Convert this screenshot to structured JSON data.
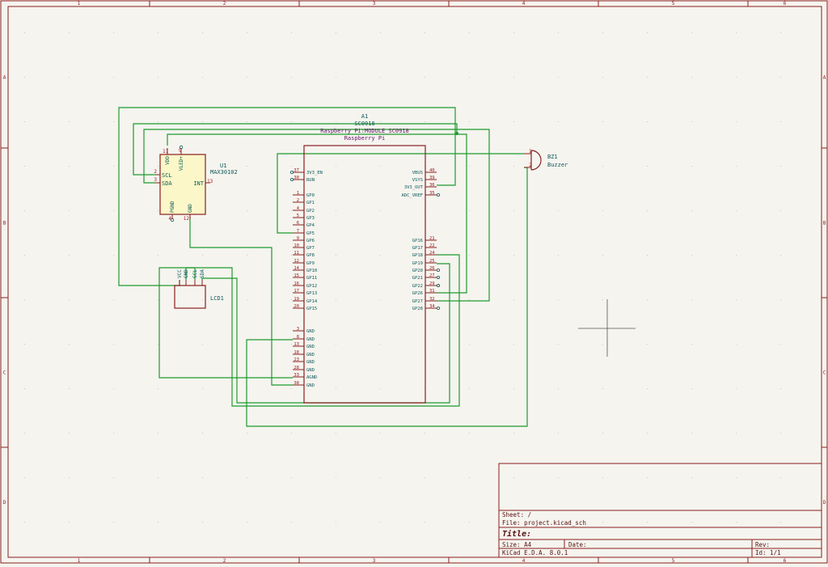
{
  "colors": {
    "background": "#f5f4ef",
    "frame": "#8a1e1e",
    "wire": "#1f9a2c",
    "symbol_body": "#8a1e1e",
    "symbol_fill": "#fbf7c8",
    "label": "#0f5a5a",
    "pin_number": "#a01d1d",
    "value": "#6a0f6a"
  },
  "border": {
    "cols": [
      "1",
      "2",
      "3",
      "4",
      "5",
      "6"
    ],
    "rows": [
      "A",
      "B",
      "C",
      "D"
    ]
  },
  "components": {
    "a1": {
      "ref": "A1",
      "value": "SC0918",
      "footprint": "Raspberry Pi:MODULE_SC0918",
      "description": "Raspberry Pi",
      "left_pins": [
        {
          "num": "37",
          "name": "3V3_EN"
        },
        {
          "num": "30",
          "name": "RUN"
        },
        {
          "num": "1",
          "name": "GP0"
        },
        {
          "num": "2",
          "name": "GP1"
        },
        {
          "num": "4",
          "name": "GP2"
        },
        {
          "num": "5",
          "name": "GP3"
        },
        {
          "num": "6",
          "name": "GP4"
        },
        {
          "num": "7",
          "name": "GP5"
        },
        {
          "num": "9",
          "name": "GP6"
        },
        {
          "num": "10",
          "name": "GP7"
        },
        {
          "num": "11",
          "name": "GP8"
        },
        {
          "num": "12",
          "name": "GP9"
        },
        {
          "num": "14",
          "name": "GP10"
        },
        {
          "num": "15",
          "name": "GP11"
        },
        {
          "num": "16",
          "name": "GP12"
        },
        {
          "num": "17",
          "name": "GP13"
        },
        {
          "num": "19",
          "name": "GP14"
        },
        {
          "num": "20",
          "name": "GP15"
        },
        {
          "num": "3",
          "name": "GND"
        },
        {
          "num": "8",
          "name": "GND"
        },
        {
          "num": "13",
          "name": "GND"
        },
        {
          "num": "18",
          "name": "GND"
        },
        {
          "num": "23",
          "name": "GND"
        },
        {
          "num": "28",
          "name": "GND"
        },
        {
          "num": "33",
          "name": "AGND"
        },
        {
          "num": "38",
          "name": "GND"
        }
      ],
      "right_pins": [
        {
          "num": "40",
          "name": "VBUS"
        },
        {
          "num": "39",
          "name": "VSYS"
        },
        {
          "num": "36",
          "name": "3V3_OUT"
        },
        {
          "num": "35",
          "name": "ADC_VREF"
        },
        {
          "num": "21",
          "name": "GP16"
        },
        {
          "num": "22",
          "name": "GP17"
        },
        {
          "num": "24",
          "name": "GP18"
        },
        {
          "num": "25",
          "name": "GP19"
        },
        {
          "num": "26",
          "name": "GP20"
        },
        {
          "num": "27",
          "name": "GP21"
        },
        {
          "num": "29",
          "name": "GP22"
        },
        {
          "num": "31",
          "name": "GP26"
        },
        {
          "num": "32",
          "name": "GP27"
        },
        {
          "num": "34",
          "name": "GP28"
        }
      ]
    },
    "u1": {
      "ref": "U1",
      "value": "MAX30102",
      "pins": [
        {
          "num": "2",
          "name": "SCL"
        },
        {
          "num": "3",
          "name": "SDA"
        },
        {
          "num": "11",
          "name": "VDD"
        },
        {
          "num": "9",
          "name": "VLED+"
        },
        {
          "num": "13",
          "name": "INT"
        },
        {
          "num": "4",
          "name": "PGND"
        },
        {
          "num": "12",
          "name": "GND"
        }
      ]
    },
    "lcd1": {
      "ref": "LCD1",
      "pins": [
        "VCC",
        "GND",
        "SCL",
        "SDA"
      ]
    },
    "bz1": {
      "ref": "BZ1",
      "value": "Buzzer",
      "pins": [
        {
          "num": "1"
        },
        {
          "num": "2"
        }
      ]
    }
  },
  "title_block": {
    "sheet": "Sheet: /",
    "file": "File: project.kicad_sch",
    "title": "Title:",
    "size": "Size: A4",
    "date": "Date:",
    "rev": "Rev:",
    "tool": "KiCad E.D.A. 8.0.1",
    "id": "Id: 1/1"
  }
}
